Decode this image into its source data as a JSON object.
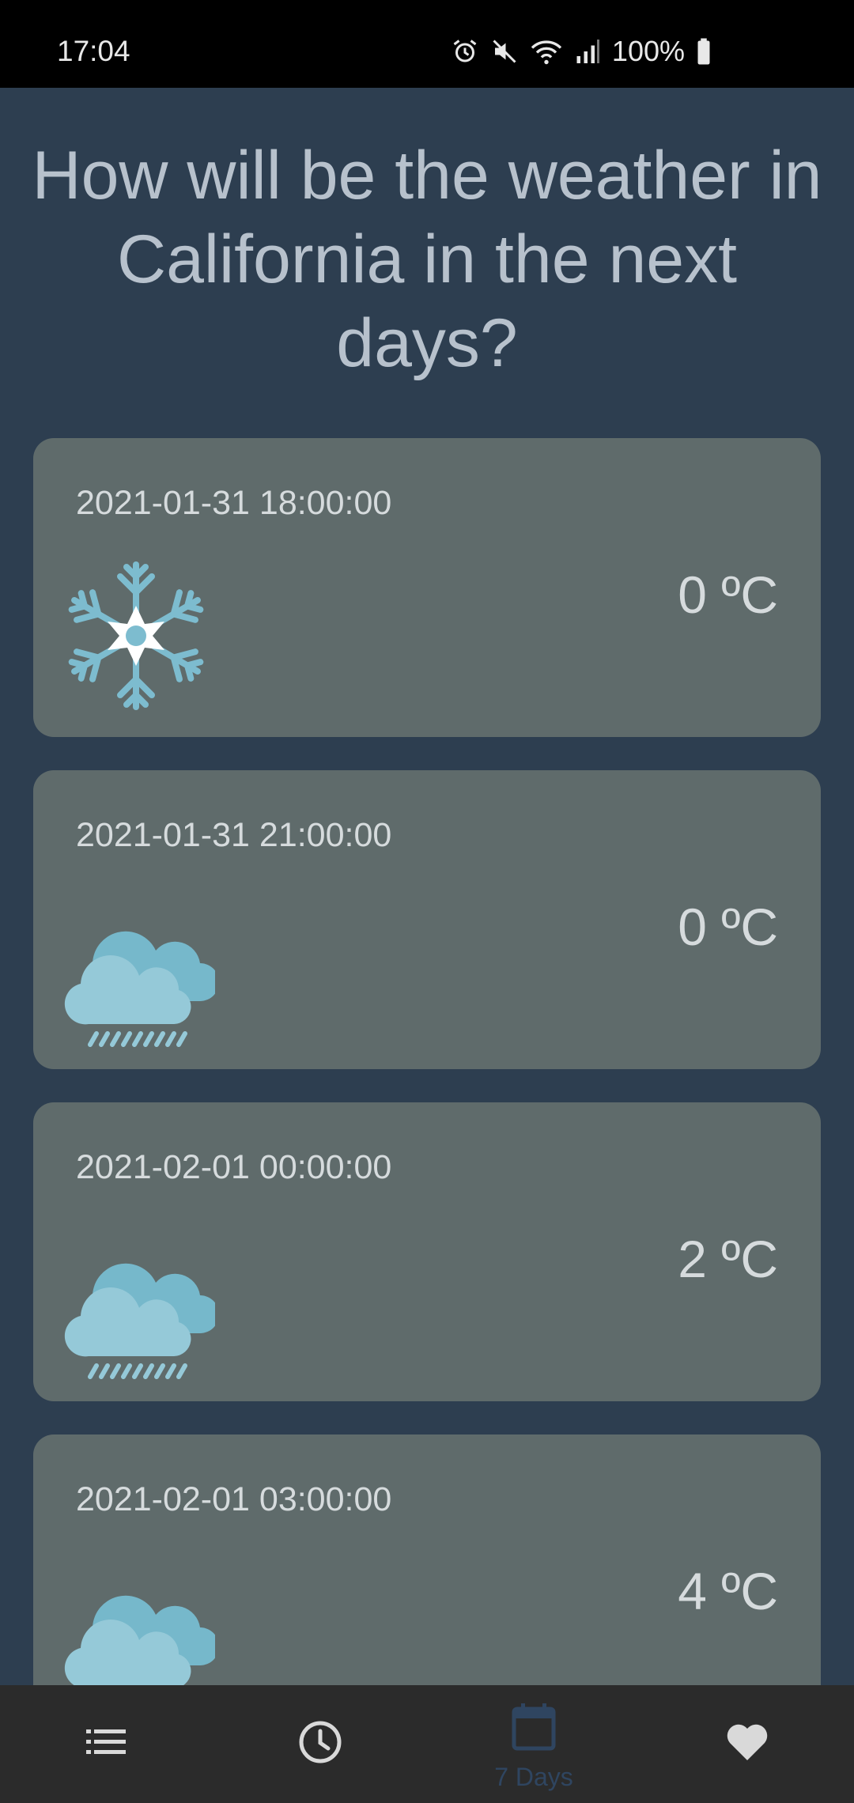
{
  "status_bar": {
    "time": "17:04",
    "battery": "100%"
  },
  "page": {
    "title": "How will be the weather in California in the next days?"
  },
  "forecasts": [
    {
      "datetime": "2021-01-31 18:00:00",
      "temperature": "0 ºC",
      "icon": "snowflake-icon"
    },
    {
      "datetime": "2021-01-31 21:00:00",
      "temperature": "0 ºC",
      "icon": "rain-cloud-icon"
    },
    {
      "datetime": "2021-02-01 00:00:00",
      "temperature": "2 ºC",
      "icon": "rain-cloud-icon"
    },
    {
      "datetime": "2021-02-01 03:00:00",
      "temperature": "4 ºC",
      "icon": "rain-cloud-icon"
    }
  ],
  "bottom_nav": {
    "items": [
      {
        "icon": "list-icon",
        "label": ""
      },
      {
        "icon": "clock-icon",
        "label": ""
      },
      {
        "icon": "calendar-icon",
        "label": "7 Days"
      },
      {
        "icon": "heart-icon",
        "label": ""
      }
    ],
    "active_index": 2
  },
  "colors": {
    "background": "#2d3e50",
    "card": "#5f6b6b",
    "card_text": "#d6dbdd",
    "title_text": "#b7c1cc",
    "icon_blue": "#7dbccf",
    "nav_bg": "#2b2b2b",
    "nav_active": "#2f4560"
  }
}
